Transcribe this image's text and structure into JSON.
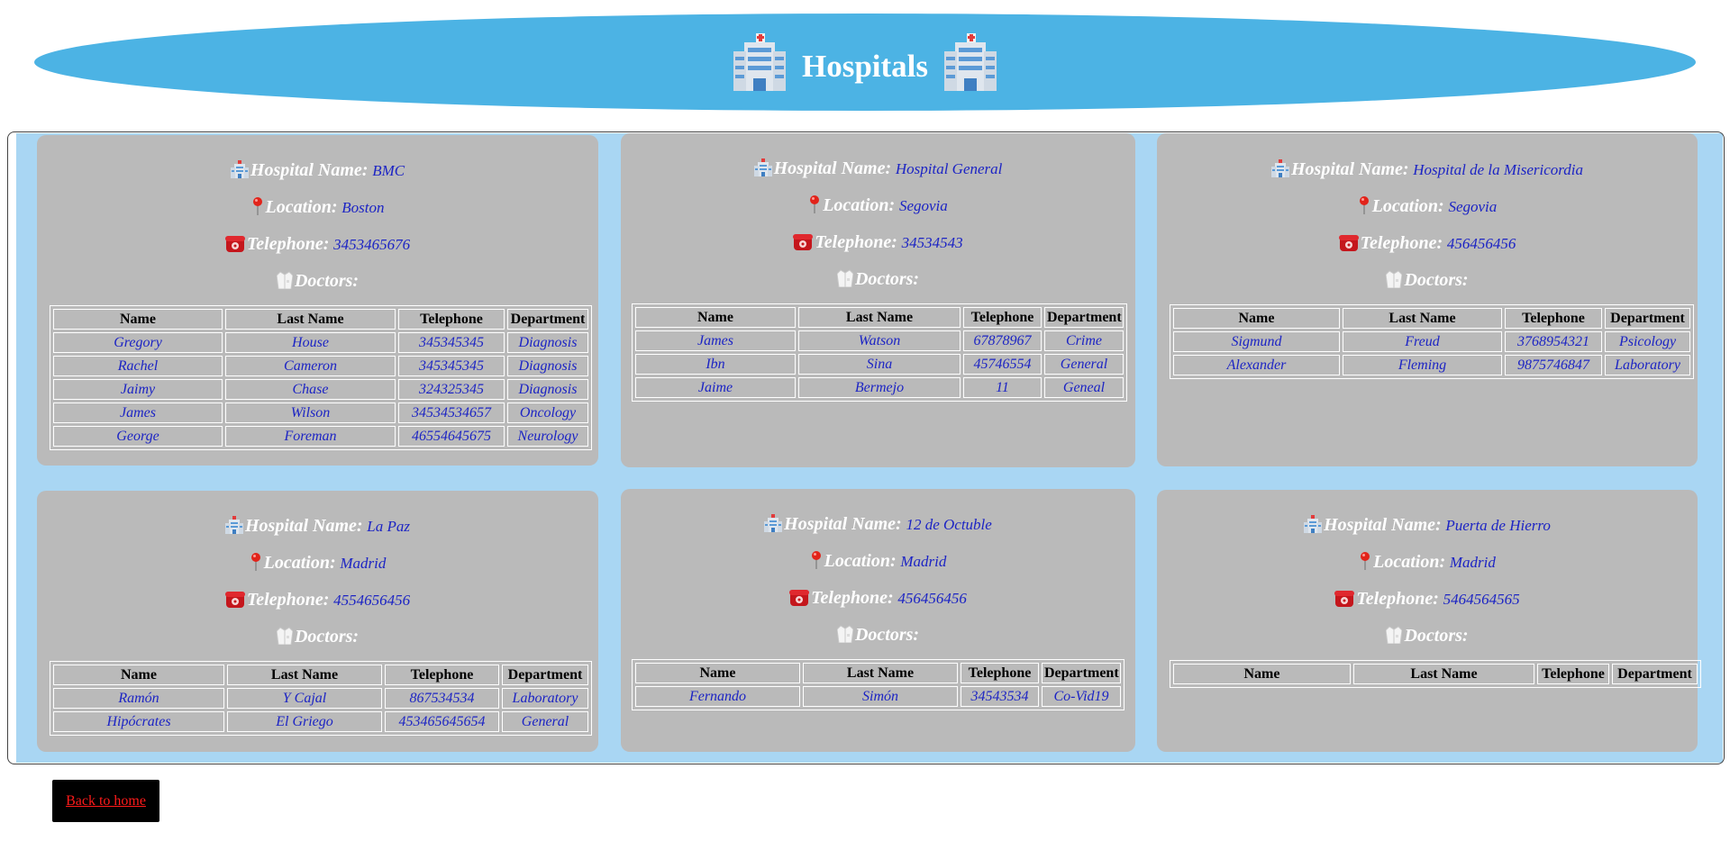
{
  "header": {
    "title": "Hospitals",
    "icon": "hospital-icon"
  },
  "labels": {
    "hospital_name": "Hospital Name:",
    "location": "Location:",
    "telephone": "Telephone:",
    "doctors": "Doctors:"
  },
  "table_headers": [
    "Name",
    "Last Name",
    "Telephone",
    "Department"
  ],
  "hospitals": [
    {
      "name": "BMC",
      "location": "Boston",
      "telephone": "3453465676",
      "doctors": [
        [
          "Gregory",
          "House",
          "345345345",
          "Diagnosis"
        ],
        [
          "Rachel",
          "Cameron",
          "345345345",
          "Diagnosis"
        ],
        [
          "Jaimy",
          "Chase",
          "324325345",
          "Diagnosis"
        ],
        [
          "James",
          "Wilson",
          "34534534657",
          "Oncology"
        ],
        [
          "George",
          "Foreman",
          "46554645675",
          "Neurology"
        ]
      ]
    },
    {
      "name": "Hospital General",
      "location": "Segovia",
      "telephone": "34534543",
      "doctors": [
        [
          "James",
          "Watson",
          "67878967",
          "Crime"
        ],
        [
          "Ibn",
          "Sina",
          "45746554",
          "General"
        ],
        [
          "Jaime",
          "Bermejo",
          "11",
          "Geneal"
        ]
      ]
    },
    {
      "name": "Hospital de la Misericordia",
      "location": "Segovia",
      "telephone": "456456456",
      "doctors": [
        [
          "Sigmund",
          "Freud",
          "3768954321",
          "Psicology"
        ],
        [
          "Alexander",
          "Fleming",
          "9875746847",
          "Laboratory"
        ]
      ]
    },
    {
      "name": "La Paz",
      "location": "Madrid",
      "telephone": "4554656456",
      "doctors": [
        [
          "Ramón",
          "Y Cajal",
          "867534534",
          "Laboratory"
        ],
        [
          "Hipócrates",
          "El Griego",
          "453465645654",
          "General"
        ]
      ]
    },
    {
      "name": "12 de Octuble",
      "location": "Madrid",
      "telephone": "456456456",
      "doctors": [
        [
          "Fernando",
          "Simón",
          "34543534",
          "Co-Vid19"
        ]
      ]
    },
    {
      "name": "Puerta de Hierro",
      "location": "Madrid",
      "telephone": "5464564565",
      "doctors": []
    }
  ],
  "footer": {
    "back_link": "Back to home"
  },
  "colors": {
    "header_bg": "#4cb3e4",
    "grid_bg": "#a9d6f3",
    "card_bg": "#bababa",
    "value_text": "#1c24c4",
    "link": "#ff1a1a"
  }
}
